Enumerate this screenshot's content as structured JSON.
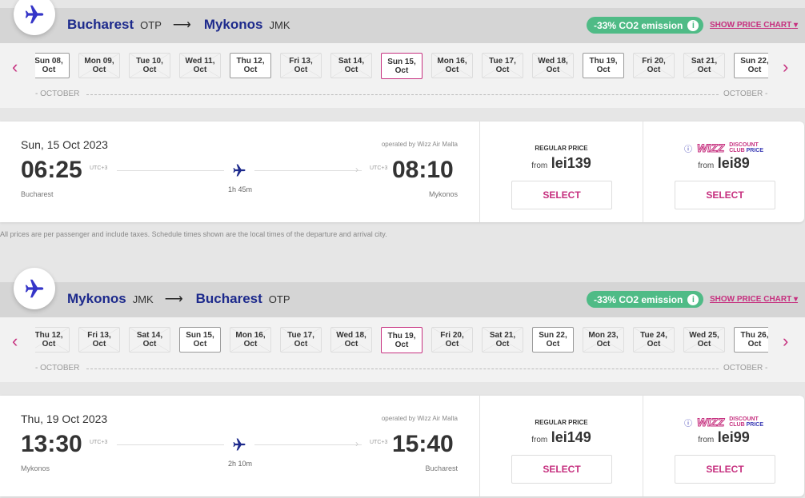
{
  "colors": {
    "accent": "#c6307f",
    "brand": "#1d2a8c",
    "co2": "#4fbb86"
  },
  "footnote": "All prices are per passenger and include taxes. Schedule times shown are the local times of the departure and arrival city.",
  "flights": [
    {
      "origin": "Bucharest",
      "origin_code": "OTP",
      "dest": "Mykonos",
      "dest_code": "JMK",
      "co2": "-33% CO2 emission",
      "price_chart": "SHOW PRICE CHART",
      "month_left": "OCTOBER",
      "month_right": "OCTOBER",
      "dates": [
        {
          "label": "Sun 08, Oct",
          "state": "available"
        },
        {
          "label": "Mon 09, Oct",
          "state": "unavailable"
        },
        {
          "label": "Tue 10, Oct",
          "state": "unavailable"
        },
        {
          "label": "Wed 11, Oct",
          "state": "unavailable"
        },
        {
          "label": "Thu 12, Oct",
          "state": "available"
        },
        {
          "label": "Fri 13, Oct",
          "state": "unavailable"
        },
        {
          "label": "Sat 14, Oct",
          "state": "unavailable"
        },
        {
          "label": "Sun 15, Oct",
          "state": "selected"
        },
        {
          "label": "Mon 16, Oct",
          "state": "unavailable"
        },
        {
          "label": "Tue 17, Oct",
          "state": "unavailable"
        },
        {
          "label": "Wed 18, Oct",
          "state": "unavailable"
        },
        {
          "label": "Thu 19, Oct",
          "state": "available"
        },
        {
          "label": "Fri 20, Oct",
          "state": "unavailable"
        },
        {
          "label": "Sat 21, Oct",
          "state": "unavailable"
        },
        {
          "label": "Sun 22, Oct",
          "state": "available"
        }
      ],
      "date": "Sun, 15 Oct 2023",
      "operated": "operated by Wizz Air Malta",
      "dep": "06:25",
      "arr": "08:10",
      "utc_dep": "UTC+3",
      "utc_arr": "UTC+3",
      "duration": "1h 45m",
      "dep_city": "Bucharest",
      "arr_city": "Mykonos",
      "regular_label": "REGULAR PRICE",
      "from": "from",
      "regular_price": "lei139",
      "club_logo": "WIZZ",
      "club_line1": "DISCOUNT",
      "club_line2a": "CLUB ",
      "club_line2b": "PRICE",
      "club_price": "lei89",
      "select": "SELECT"
    },
    {
      "origin": "Mykonos",
      "origin_code": "JMK",
      "dest": "Bucharest",
      "dest_code": "OTP",
      "co2": "-33% CO2 emission",
      "price_chart": "SHOW PRICE CHART",
      "month_left": "OCTOBER",
      "month_right": "OCTOBER",
      "dates": [
        {
          "label": "Thu 12, Oct",
          "state": "unavailable"
        },
        {
          "label": "Fri 13, Oct",
          "state": "unavailable"
        },
        {
          "label": "Sat 14, Oct",
          "state": "unavailable"
        },
        {
          "label": "Sun 15, Oct",
          "state": "available"
        },
        {
          "label": "Mon 16, Oct",
          "state": "unavailable"
        },
        {
          "label": "Tue 17, Oct",
          "state": "unavailable"
        },
        {
          "label": "Wed 18, Oct",
          "state": "unavailable"
        },
        {
          "label": "Thu 19, Oct",
          "state": "selected"
        },
        {
          "label": "Fri 20, Oct",
          "state": "unavailable"
        },
        {
          "label": "Sat 21, Oct",
          "state": "unavailable"
        },
        {
          "label": "Sun 22, Oct",
          "state": "available"
        },
        {
          "label": "Mon 23, Oct",
          "state": "unavailable"
        },
        {
          "label": "Tue 24, Oct",
          "state": "unavailable"
        },
        {
          "label": "Wed 25, Oct",
          "state": "unavailable"
        },
        {
          "label": "Thu 26, Oct",
          "state": "available"
        }
      ],
      "date": "Thu, 19 Oct 2023",
      "operated": "operated by Wizz Air Malta",
      "dep": "13:30",
      "arr": "15:40",
      "utc_dep": "UTC+3",
      "utc_arr": "UTC+3",
      "duration": "2h 10m",
      "dep_city": "Mykonos",
      "arr_city": "Bucharest",
      "regular_label": "REGULAR PRICE",
      "from": "from",
      "regular_price": "lei149",
      "club_logo": "WIZZ",
      "club_line1": "DISCOUNT",
      "club_line2a": "CLUB ",
      "club_line2b": "PRICE",
      "club_price": "lei99",
      "select": "SELECT"
    }
  ]
}
